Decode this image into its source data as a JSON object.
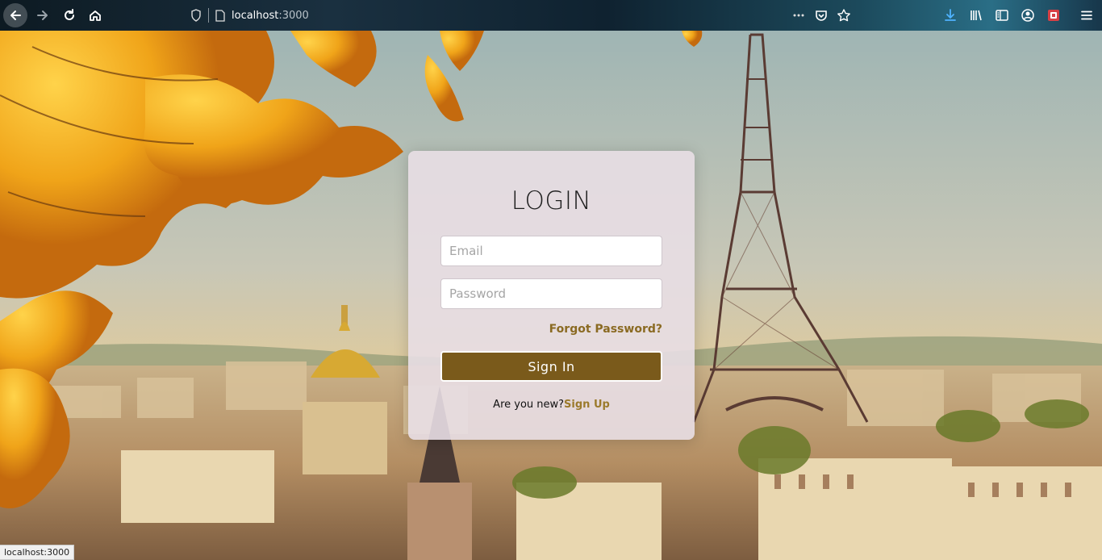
{
  "browser": {
    "url_host": "localhost",
    "url_port": ":3000",
    "icons": [
      "back-arrow-icon",
      "forward-arrow-icon",
      "reload-icon",
      "home-icon",
      "shield-icon",
      "page-icon",
      "more-icon",
      "pocket-icon",
      "star-icon",
      "download-icon",
      "library-icon",
      "sidebar-icon",
      "account-icon",
      "extension-icon",
      "menu-icon"
    ]
  },
  "login": {
    "title": "LOGIN",
    "email_placeholder": "Email",
    "password_placeholder": "Password",
    "forgot_label": "Forgot Password?",
    "signin_label": "Sign In",
    "new_prompt": "Are you new?",
    "signup_label": "Sign Up"
  },
  "status_bar": {
    "text": "localhost:3000"
  },
  "colors": {
    "accent": "#7a5a1b",
    "link": "#8a6a22"
  }
}
